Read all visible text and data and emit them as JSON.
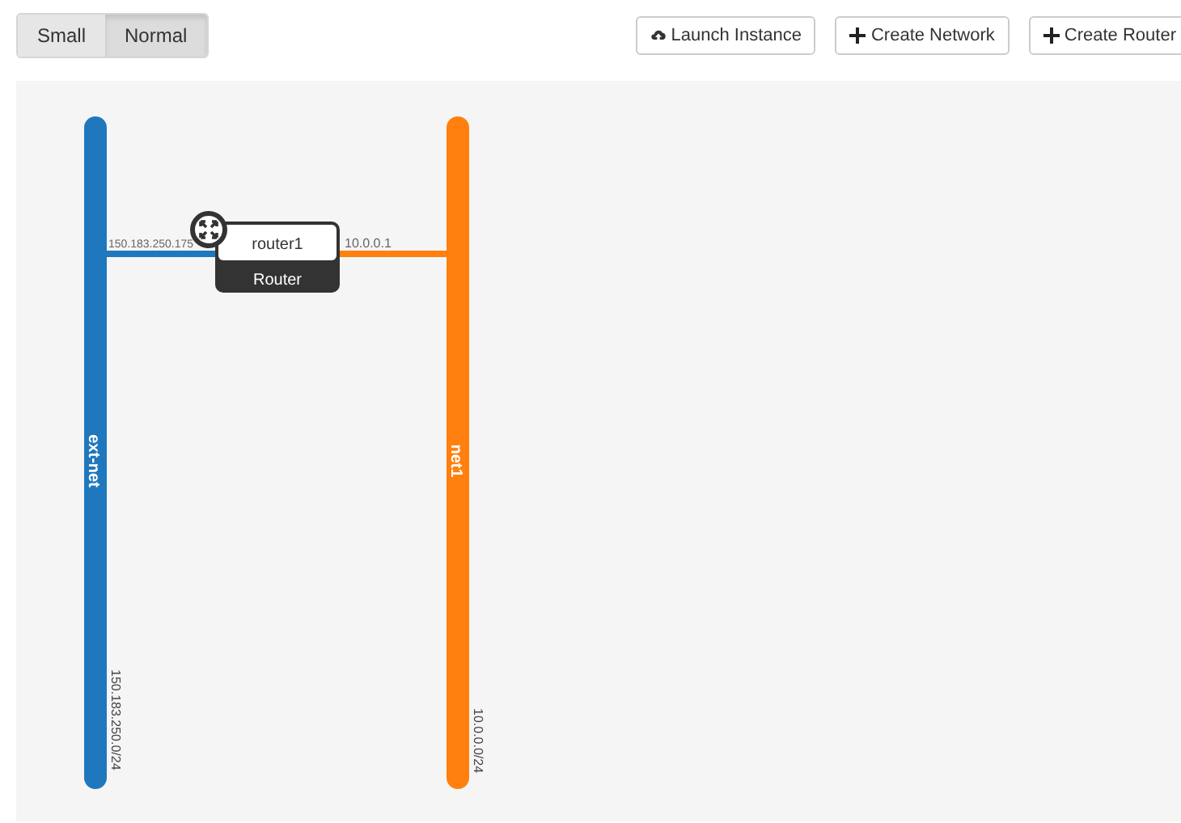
{
  "size_toggle": [
    {
      "label": "Small",
      "selected": false
    },
    {
      "label": "Normal",
      "selected": true
    }
  ],
  "actions": [
    {
      "label": "Launch Instance",
      "kind": "launch"
    },
    {
      "label": "Create Network",
      "kind": "add"
    },
    {
      "label": "Create Router",
      "kind": "add"
    }
  ],
  "networks": [
    {
      "name": "ext-net",
      "cidr": "150.183.250.0/24",
      "color": "#1f78bd"
    },
    {
      "name": "net1",
      "cidr": "10.0.0.0/24",
      "color": "#ff800e"
    }
  ],
  "routers": [
    {
      "name": "router1",
      "type_label": "Router",
      "ports": [
        {
          "ip": "150.183.250.175"
        },
        {
          "ip": "10.0.0.1"
        }
      ]
    }
  ]
}
